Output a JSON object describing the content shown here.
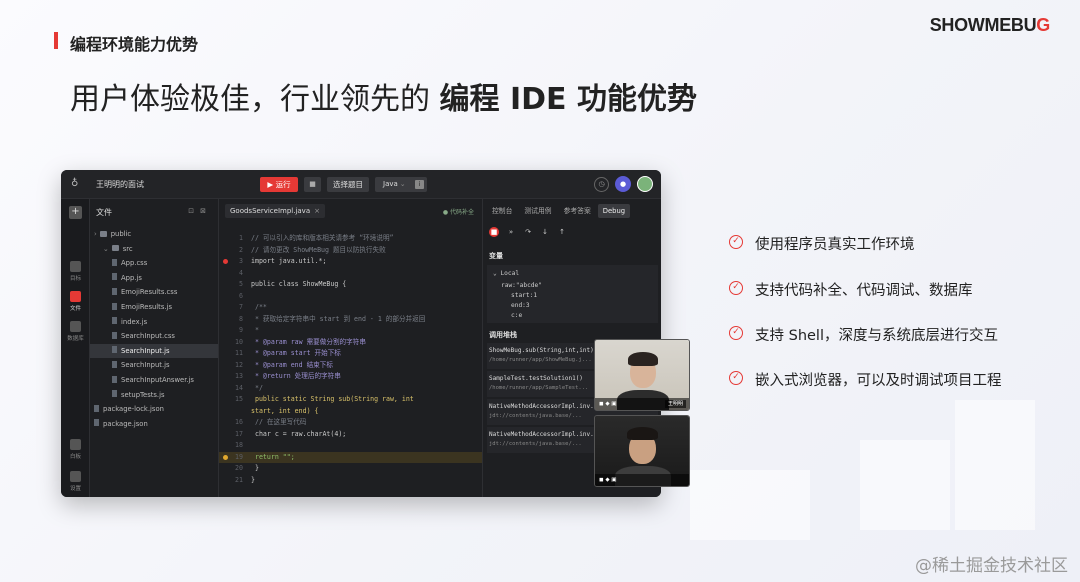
{
  "slide": {
    "section_title": "编程环境能力优势",
    "headline_normal": "用户体验极佳，行业领先的 ",
    "headline_bold": "编程 IDE 功能优势",
    "logo_main": "SHOWMEBU",
    "logo_accent": "G",
    "watermark": "@稀土掘金技术社区",
    "accent_color": "#e53935"
  },
  "ide": {
    "logo_icon": "lamp-icon",
    "project_name": "王明明的面试",
    "run_label": "运行",
    "choose_label": "选择题目",
    "language": "Java",
    "rail": [
      {
        "label": "目标",
        "icon": "target-icon"
      },
      {
        "label": "文件",
        "icon": "folder-icon",
        "active": true
      },
      {
        "label": "数据库",
        "icon": "database-icon"
      },
      {
        "label": "白板",
        "icon": "whiteboard-icon"
      },
      {
        "label": "设置",
        "icon": "gear-icon"
      }
    ],
    "files_title": "文件",
    "tree": [
      {
        "name": "public",
        "type": "folder",
        "indent": 1,
        "arrow": "›"
      },
      {
        "name": "src",
        "type": "folder",
        "indent": 2,
        "arrow": "⌄"
      },
      {
        "name": "App.css",
        "type": "file",
        "indent": 3
      },
      {
        "name": "App.js",
        "type": "file",
        "indent": 3
      },
      {
        "name": "EmojiResults.css",
        "type": "file",
        "indent": 3
      },
      {
        "name": "EmojiResults.js",
        "type": "file",
        "indent": 3
      },
      {
        "name": "index.js",
        "type": "file",
        "indent": 3
      },
      {
        "name": "SearchInput.css",
        "type": "file",
        "indent": 3
      },
      {
        "name": "SearchInput.js",
        "type": "file",
        "indent": 3,
        "selected": true
      },
      {
        "name": "SearchInput.js",
        "type": "file",
        "indent": 3
      },
      {
        "name": "SearchInputAnswer.js",
        "type": "file",
        "indent": 3
      },
      {
        "name": "setupTests.js",
        "type": "file",
        "indent": 3
      },
      {
        "name": "package-lock.json",
        "type": "file",
        "indent": 1
      },
      {
        "name": "package.json",
        "type": "file",
        "indent": 1
      }
    ],
    "editor_tab": "GoodsServiceImpl.java",
    "editor_hint": "● 代码补全",
    "code": [
      {
        "n": "1",
        "t": "// 可以引入的库和版本相关请参考 “环境说明”",
        "c": "com"
      },
      {
        "n": "2",
        "t": "// 请勿更改  ShowMeBug  题目以防执行失败",
        "c": "com"
      },
      {
        "n": "3",
        "t": "import java.util.*;",
        "c": "plain",
        "bp": "red"
      },
      {
        "n": "4",
        "t": "",
        "c": "plain"
      },
      {
        "n": "5",
        "t": "public class ShowMeBug {",
        "c": "plain"
      },
      {
        "n": "6",
        "t": "",
        "c": "plain"
      },
      {
        "n": "7",
        "t": "    /**",
        "c": "com"
      },
      {
        "n": "8",
        "t": "     * 获取给定字符串中 start 到 end - 1 的部分并返回",
        "c": "com"
      },
      {
        "n": "9",
        "t": "     *",
        "c": "com"
      },
      {
        "n": "10",
        "t": "     * @param raw   需要做分割的字符串",
        "c": "doc"
      },
      {
        "n": "11",
        "t": "     * @param start 开始下标",
        "c": "doc"
      },
      {
        "n": "12",
        "t": "     * @param end   结束下标",
        "c": "doc"
      },
      {
        "n": "13",
        "t": "     * @return 处理后的字符串",
        "c": "doc"
      },
      {
        "n": "14",
        "t": "     */",
        "c": "com"
      },
      {
        "n": "15",
        "t": "    public static String sub(String raw, int",
        "c": "kw"
      },
      {
        "n": "",
        "t": "start, int end) {",
        "c": "kw"
      },
      {
        "n": "16",
        "t": "        // 在这里写代码",
        "c": "com"
      },
      {
        "n": "17",
        "t": "        char c = raw.charAt(4);",
        "c": "plain"
      },
      {
        "n": "18",
        "t": "",
        "c": "plain"
      },
      {
        "n": "19",
        "t": "        return \"\";",
        "c": "str",
        "bp": "yellow",
        "hl": true
      },
      {
        "n": "20",
        "t": "    }",
        "c": "plain"
      },
      {
        "n": "21",
        "t": "}",
        "c": "plain"
      }
    ],
    "panel_tabs": [
      "控制台",
      "测试用例",
      "参考答案",
      "Debug"
    ],
    "panel_active": "Debug",
    "debug_buttons": [
      {
        "label": "■",
        "icon": "stop-icon"
      },
      {
        "label": "»",
        "icon": "resume-icon"
      },
      {
        "label": "↷",
        "icon": "step-over-icon"
      },
      {
        "label": "↓",
        "icon": "step-into-icon"
      },
      {
        "label": "↑",
        "icon": "step-out-icon"
      }
    ],
    "vars_title": "变量",
    "vars_scope": "Local",
    "vars": [
      "raw:\"abcde\"",
      "start:1",
      "end:3",
      "c:e"
    ],
    "stack_title": "调用堆栈",
    "stack": [
      {
        "l1": "ShowMeBug.sub(String,int,int)",
        "l2": "/home/runner/app/ShowMeBug.j..."
      },
      {
        "l1": "SampleTest.testSolution1()",
        "l2": "/home/runner/app/SampleTest..."
      },
      {
        "l1": "NativeMethodAccessorImpl.inv...",
        "l2": "jdt://contents/java.base/..."
      },
      {
        "l1": "NativeMethodAccessorImpl.inv...",
        "l2": "jdt://contents/java.base/..."
      }
    ]
  },
  "video": {
    "caller1_name": "王明明"
  },
  "features": [
    "使用程序员真实工作环境",
    "支持代码补全、代码调试、数据库",
    "支持 Shell，深度与系统底层进行交互",
    "嵌入式浏览器，可以及时调试项目工程"
  ]
}
